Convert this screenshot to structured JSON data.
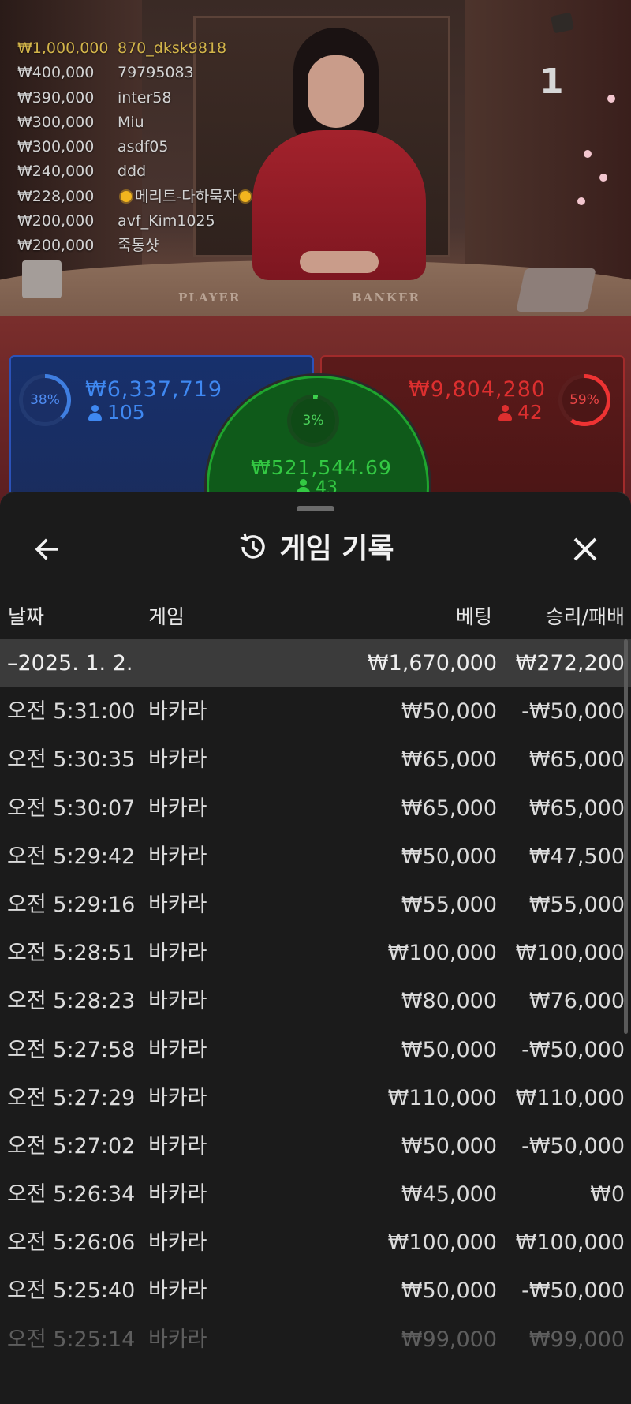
{
  "stream": {
    "round_number": "1",
    "table_labels": {
      "player": "PLAYER",
      "banker": "BANKER"
    }
  },
  "leaderboard": [
    {
      "amount": "₩1,000,000",
      "user": "870_dksk9818"
    },
    {
      "amount": "₩400,000",
      "user": "79795083"
    },
    {
      "amount": "₩390,000",
      "user": "inter58"
    },
    {
      "amount": "₩300,000",
      "user": "Miu"
    },
    {
      "amount": "₩300,000",
      "user": "asdf05"
    },
    {
      "amount": "₩240,000",
      "user": "ddd"
    },
    {
      "amount": "₩228,000",
      "user": "메리트-다하묵자"
    },
    {
      "amount": "₩200,000",
      "user": "avf_Kim1025"
    },
    {
      "amount": "₩200,000",
      "user": "죽통샷"
    }
  ],
  "bets": {
    "player": {
      "percent": "38%",
      "amount": "₩6,337,719",
      "players": "105",
      "color": "#3f88f1"
    },
    "banker": {
      "percent": "59%",
      "amount": "₩9,804,280",
      "players": "42",
      "color": "#dd2f2f"
    },
    "tie": {
      "percent": "3%",
      "amount": "₩521,544.69",
      "players": "43",
      "color": "#33c843"
    }
  },
  "history_sheet": {
    "title": "게임 기록",
    "icons": {
      "back": "back-arrow-icon",
      "history": "history-icon",
      "close": "close-icon"
    },
    "columns": {
      "date": "날짜",
      "game": "게임",
      "bet": "베팅",
      "result": "승리/패배"
    },
    "day_summary": {
      "date": "–2025. 1. 2.",
      "bet": "₩1,670,000",
      "result": "₩272,200"
    },
    "rows": [
      {
        "time": "오전 5:31:00",
        "game": "바카라",
        "bet": "₩50,000",
        "result": "-₩50,000"
      },
      {
        "time": "오전 5:30:35",
        "game": "바카라",
        "bet": "₩65,000",
        "result": "₩65,000"
      },
      {
        "time": "오전 5:30:07",
        "game": "바카라",
        "bet": "₩65,000",
        "result": "₩65,000"
      },
      {
        "time": "오전 5:29:42",
        "game": "바카라",
        "bet": "₩50,000",
        "result": "₩47,500"
      },
      {
        "time": "오전 5:29:16",
        "game": "바카라",
        "bet": "₩55,000",
        "result": "₩55,000"
      },
      {
        "time": "오전 5:28:51",
        "game": "바카라",
        "bet": "₩100,000",
        "result": "₩100,000"
      },
      {
        "time": "오전 5:28:23",
        "game": "바카라",
        "bet": "₩80,000",
        "result": "₩76,000"
      },
      {
        "time": "오전 5:27:58",
        "game": "바카라",
        "bet": "₩50,000",
        "result": "-₩50,000"
      },
      {
        "time": "오전 5:27:29",
        "game": "바카라",
        "bet": "₩110,000",
        "result": "₩110,000"
      },
      {
        "time": "오전 5:27:02",
        "game": "바카라",
        "bet": "₩50,000",
        "result": "-₩50,000"
      },
      {
        "time": "오전 5:26:34",
        "game": "바카라",
        "bet": "₩45,000",
        "result": "₩0"
      },
      {
        "time": "오전 5:26:06",
        "game": "바카라",
        "bet": "₩100,000",
        "result": "₩100,000"
      },
      {
        "time": "오전 5:25:40",
        "game": "바카라",
        "bet": "₩50,000",
        "result": "-₩50,000"
      },
      {
        "time": "오전 5:25:14",
        "game": "바카라",
        "bet": "₩99,000",
        "result": "₩99,000"
      }
    ]
  }
}
